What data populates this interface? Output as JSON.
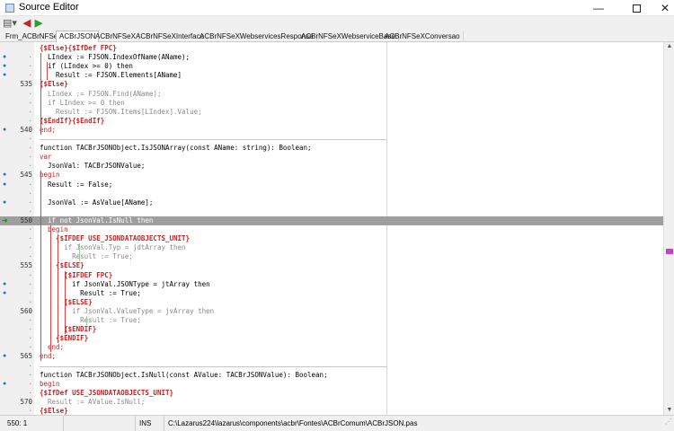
{
  "window": {
    "title": "Source Editor",
    "minimize": "—",
    "close": "✕"
  },
  "toolbar": {
    "jump_icon": "jump-icon",
    "back_icon": "back-arrow-icon",
    "forward_icon": "forward-arrow-icon"
  },
  "tabs": [
    "Frm_ACBrNFSeX",
    "ACBrJSON",
    "ACBrNFSeX",
    "ACBrNFSeXInterface",
    "ACBrNFSeXWebservicesResponse",
    "ACBrNFSeXWebserviceBase",
    "ACBrNFSeXConversao"
  ],
  "active_tab": "ACBrJSON",
  "editor": {
    "highlight_color": "#9e9e9e",
    "lines": [
      {
        "no": "",
        "text": "{$Else}{$IfDef FPC}",
        "style": "dir"
      },
      {
        "no": "·",
        "text": "  LIndex := FJSON.IndexOfName(AName);",
        "style": "normal",
        "bp": true
      },
      {
        "no": "·",
        "text": "  if (LIndex >= 0) then",
        "style": "normal",
        "bp": true
      },
      {
        "no": "·",
        "text": "    Result := FJSON.Elements[AName]",
        "style": "normal",
        "bp": true
      },
      {
        "no": "535",
        "text": "{$Else}",
        "style": "dir"
      },
      {
        "no": "·",
        "text": "  LIndex := FJSON.Find(AName);",
        "style": "grey"
      },
      {
        "no": "·",
        "text": "  if LIndex >= 0 then",
        "style": "grey"
      },
      {
        "no": "·",
        "text": "    Result := FJSON.Items[LIndex].Value;",
        "style": "grey"
      },
      {
        "no": "·",
        "text": "{$EndIf}{$EndIf}",
        "style": "dir"
      },
      {
        "no": "540",
        "text": "end;",
        "style": "red",
        "bp": true
      },
      {
        "no": "·",
        "text": "",
        "style": "normal"
      },
      {
        "no": "·",
        "text": "function TACBrJSONObject.IsJSONArray(const AName: string): Boolean;",
        "style": "normal"
      },
      {
        "no": "·",
        "text": "var",
        "style": "red"
      },
      {
        "no": "·",
        "text": "  JsonVal: TACBrJSONValue;",
        "style": "normal"
      },
      {
        "no": "545",
        "text": "begin",
        "style": "red",
        "bp": true
      },
      {
        "no": "·",
        "text": "  Result := False;",
        "style": "normal",
        "bp": true
      },
      {
        "no": "·",
        "text": "",
        "style": "normal"
      },
      {
        "no": "·",
        "text": "  JsonVal := AsValue[AName];",
        "style": "normal",
        "bp": true
      },
      {
        "no": "·",
        "text": "",
        "style": "normal"
      },
      {
        "no": "550",
        "text": "  if not JsonVal.IsNull then",
        "style": "normal",
        "exec": true,
        "hl": true
      },
      {
        "no": "·",
        "text": "  begin",
        "style": "red"
      },
      {
        "no": "·",
        "text": "    {$IFDEF USE_JSONDATAOBJECTS_UNIT}",
        "style": "dir"
      },
      {
        "no": "·",
        "text": "      if JsonVal.Typ = jdtArray then",
        "style": "grey"
      },
      {
        "no": "·",
        "text": "        Result := True;",
        "style": "grey"
      },
      {
        "no": "555",
        "text": "    {$ELSE}",
        "style": "dir"
      },
      {
        "no": "·",
        "text": "      {$IFDEF FPC}",
        "style": "dir"
      },
      {
        "no": "·",
        "text": "        if JsonVal.JSONType = jtArray then",
        "style": "normal",
        "bp": true
      },
      {
        "no": "·",
        "text": "          Result := True;",
        "style": "normal",
        "bp": true
      },
      {
        "no": "·",
        "text": "      {$ELSE}",
        "style": "dir"
      },
      {
        "no": "560",
        "text": "        if JsonVal.ValueType = jvArray then",
        "style": "grey"
      },
      {
        "no": "·",
        "text": "          Result := True;",
        "style": "grey"
      },
      {
        "no": "·",
        "text": "      {$ENDIF}",
        "style": "dir"
      },
      {
        "no": "·",
        "text": "    {$ENDIF}",
        "style": "dir"
      },
      {
        "no": "·",
        "text": "  end;",
        "style": "red"
      },
      {
        "no": "565",
        "text": "end;",
        "style": "red",
        "bp": true
      },
      {
        "no": "·",
        "text": "",
        "style": "normal"
      },
      {
        "no": "·",
        "text": "function TACBrJSONObject.IsNull(const AValue: TACBrJSONValue): Boolean;",
        "style": "normal"
      },
      {
        "no": "·",
        "text": "begin",
        "style": "red",
        "bp": true
      },
      {
        "no": "·",
        "text": "{$IfDef USE_JSONDATAOBJECTS_UNIT}",
        "style": "dir"
      },
      {
        "no": "570",
        "text": "  Result := AValue.IsNull;",
        "style": "grey"
      },
      {
        "no": "·",
        "text": "{$Else}",
        "style": "dir"
      }
    ]
  },
  "status": {
    "position": "550:  1",
    "modified": "",
    "mode": "INS",
    "file": "C:\\Lazarus224\\lazarus\\components\\acbr\\Fontes\\ACBrComum\\ACBrJSON.pas"
  }
}
